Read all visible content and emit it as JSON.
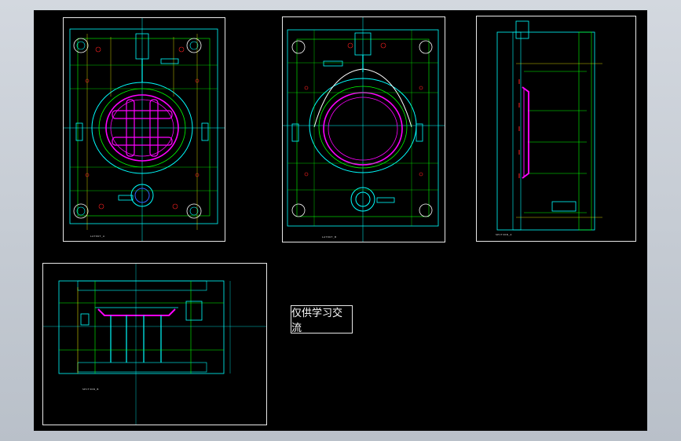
{
  "note_text": "仅供学习交流",
  "sheets": [
    {
      "id": "sheet-1",
      "label": "LAYOUT_A"
    },
    {
      "id": "sheet-2",
      "label": "LAYOUT_B"
    },
    {
      "id": "sheet-3",
      "label": "SECTION_A"
    },
    {
      "id": "sheet-4",
      "label": "SECTION_B"
    }
  ],
  "colors": {
    "background": "#000000",
    "frame": "#e8e8e8",
    "cyan": "#00ffff",
    "green": "#00ff00",
    "magenta": "#ff00ff",
    "red": "#ff2020",
    "yellow": "#ffff00",
    "white": "#ffffff",
    "blue": "#3060ff"
  }
}
